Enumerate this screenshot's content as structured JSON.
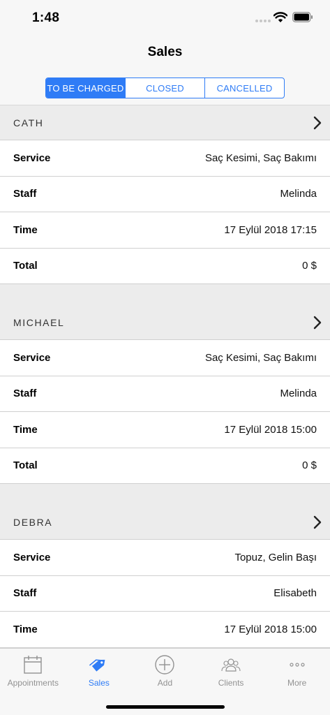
{
  "status_bar": {
    "time": "1:48"
  },
  "nav": {
    "title": "Sales"
  },
  "segments": [
    "TO BE CHARGED",
    "CLOSED",
    "CANCELLED"
  ],
  "sections": [
    {
      "name": "CATH",
      "rows": [
        {
          "label": "Service",
          "value": "Saç Kesimi, Saç Bakımı"
        },
        {
          "label": "Staff",
          "value": "Melinda"
        },
        {
          "label": "Time",
          "value": "17 Eylül 2018 17:15"
        },
        {
          "label": "Total",
          "value": "0 $"
        }
      ]
    },
    {
      "name": "MICHAEL",
      "rows": [
        {
          "label": "Service",
          "value": "Saç Kesimi, Saç Bakımı"
        },
        {
          "label": "Staff",
          "value": "Melinda"
        },
        {
          "label": "Time",
          "value": "17 Eylül 2018 15:00"
        },
        {
          "label": "Total",
          "value": "0 $"
        }
      ]
    },
    {
      "name": "DEBRA",
      "rows": [
        {
          "label": "Service",
          "value": "Topuz, Gelin Başı"
        },
        {
          "label": "Staff",
          "value": "Elisabeth"
        },
        {
          "label": "Time",
          "value": "17 Eylül 2018 15:00"
        }
      ]
    }
  ],
  "tabs": [
    {
      "label": "Appointments",
      "icon": "calendar-icon"
    },
    {
      "label": "Sales",
      "icon": "tag-icon",
      "active": true
    },
    {
      "label": "Add",
      "icon": "add-circle-icon"
    },
    {
      "label": "Clients",
      "icon": "clients-icon"
    },
    {
      "label": "More",
      "icon": "more-icon"
    }
  ],
  "colors": {
    "accent": "#2f7cf6",
    "inactive": "#929292"
  }
}
